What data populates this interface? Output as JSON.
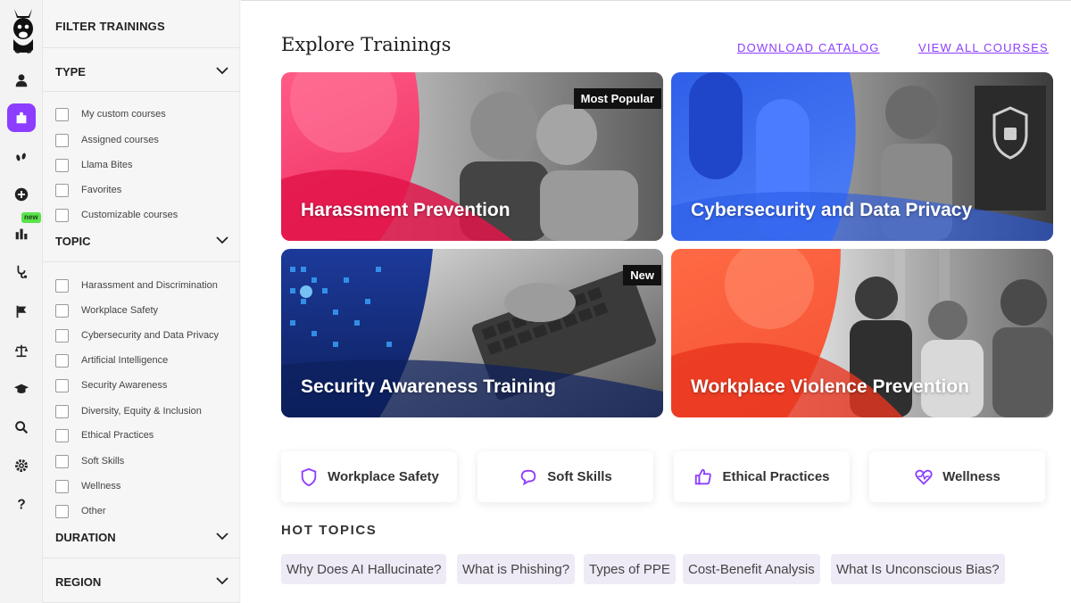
{
  "filters": {
    "title": "FILTER TRAININGS",
    "sections": {
      "type": {
        "label": "TYPE",
        "options": [
          "My custom courses",
          "Assigned courses",
          "Llama Bites",
          "Favorites",
          "Customizable courses"
        ]
      },
      "topic": {
        "label": "TOPIC",
        "options": [
          "Harassment and Discrimination",
          "Workplace Safety",
          "Cybersecurity and Data Privacy",
          "Artificial Intelligence",
          "Security Awareness",
          "Diversity, Equity & Inclusion",
          "Ethical Practices",
          "Soft Skills",
          "Wellness",
          "Other"
        ]
      },
      "duration": {
        "label": "DURATION"
      },
      "region": {
        "label": "REGION"
      }
    }
  },
  "rail": {
    "badge": "new",
    "items": [
      "user-icon",
      "puzzle-icon",
      "footprints-icon",
      "plus-circle-icon",
      "bar-chart-icon",
      "stethoscope-icon",
      "flag-icon",
      "scale-icon",
      "graduation-cap-icon",
      "search-icon",
      "gear-icon",
      "help-icon"
    ]
  },
  "main": {
    "title": "Explore Trainings",
    "download_catalog": "DOWNLOAD CATALOG",
    "view_all": "VIEW ALL COURSES",
    "cards": [
      {
        "title": "Harassment Prevention",
        "tag": "Most Popular",
        "accent": "#ff3d6e"
      },
      {
        "title": "Cybersecurity and Data Privacy",
        "tag": "",
        "accent": "#3a6cf4"
      },
      {
        "title": "Security Awareness Training",
        "tag": "New",
        "accent": "#1f3f9e"
      },
      {
        "title": "Workplace Violence Prevention",
        "tag": "",
        "accent": "#f65a3c"
      }
    ],
    "categories": [
      {
        "label": "Workplace Safety",
        "icon": "shield-icon"
      },
      {
        "label": "Soft Skills",
        "icon": "chat-bubble-icon"
      },
      {
        "label": "Ethical Practices",
        "icon": "thumbs-up-icon"
      },
      {
        "label": "Wellness",
        "icon": "heart-pulse-icon"
      }
    ],
    "hot_topics_title": "HOT TOPICS",
    "hot_topics": [
      "Why Does AI Hallucinate?",
      "What is Phishing?",
      "Types of PPE",
      "Cost-Benefit Analysis",
      "What Is Unconscious Bias?"
    ]
  },
  "colors": {
    "accent": "#8c3dff",
    "new_badge": "#5ae34b"
  }
}
